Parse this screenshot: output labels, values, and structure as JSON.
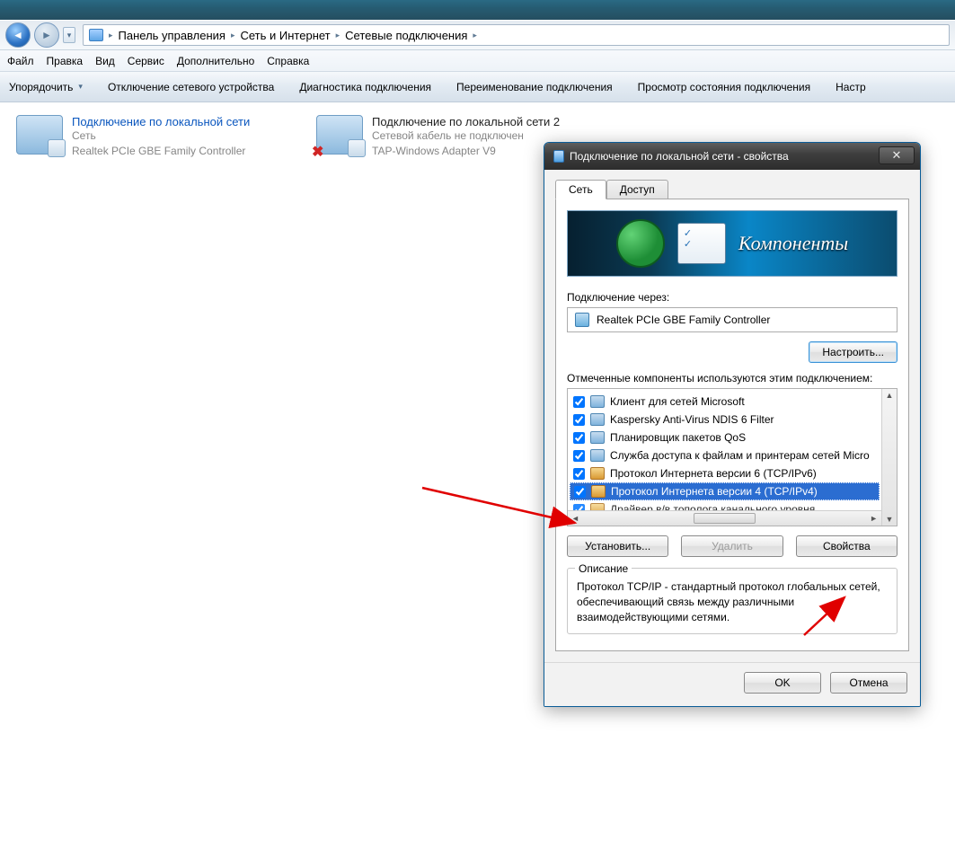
{
  "breadcrumbs": {
    "root_icon": "control-panel-icon",
    "items": [
      "Панель управления",
      "Сеть и Интернет",
      "Сетевые подключения"
    ]
  },
  "menu": {
    "file": "Файл",
    "edit": "Правка",
    "view": "Вид",
    "service": "Сервис",
    "advanced": "Дополнительно",
    "help": "Справка"
  },
  "commands": {
    "organize": "Упорядочить",
    "disable": "Отключение сетевого устройства",
    "diagnose": "Диагностика подключения",
    "rename": "Переименование подключения",
    "status": "Просмотр состояния подключения",
    "settings_trunc": "Настр"
  },
  "connections": {
    "lan1": {
      "title": "Подключение по локальной сети",
      "status": "Сеть",
      "adapter": "Realtek PCIe GBE Family Controller"
    },
    "lan2": {
      "title": "Подключение по локальной сети 2",
      "status": "Сетевой кабель не подключен",
      "adapter": "TAP-Windows Adapter V9"
    }
  },
  "dialog": {
    "title": "Подключение по локальной сети - свойства",
    "tabs": {
      "network": "Сеть",
      "access": "Доступ"
    },
    "banner": "Компоненты",
    "connect_via_label": "Подключение через:",
    "adapter": "Realtek PCIe GBE Family Controller",
    "configure": "Настроить...",
    "components_label": "Отмеченные компоненты используются этим подключением:",
    "components": [
      {
        "checked": true,
        "icon": "client",
        "name": "Клиент для сетей Microsoft"
      },
      {
        "checked": true,
        "icon": "client",
        "name": "Kaspersky Anti-Virus NDIS 6 Filter"
      },
      {
        "checked": true,
        "icon": "client",
        "name": "Планировщик пакетов QoS"
      },
      {
        "checked": true,
        "icon": "client",
        "name": "Служба доступа к файлам и принтерам сетей Micro"
      },
      {
        "checked": true,
        "icon": "proto",
        "name": "Протокол Интернета версии 6 (TCP/IPv6)"
      },
      {
        "checked": true,
        "icon": "proto",
        "name": "Протокол Интернета версии 4 (TCP/IPv4)",
        "selected": true
      },
      {
        "checked": true,
        "icon": "proto",
        "name": "Драйвер в/в тополога канального уровня",
        "cutoff": true
      }
    ],
    "install": "Установить...",
    "remove": "Удалить",
    "properties": "Свойства",
    "description_legend": "Описание",
    "description": "Протокол TCP/IP - стандартный протокол глобальных сетей, обеспечивающий связь между различными взаимодействующими сетями.",
    "ok": "OK",
    "cancel": "Отмена"
  }
}
